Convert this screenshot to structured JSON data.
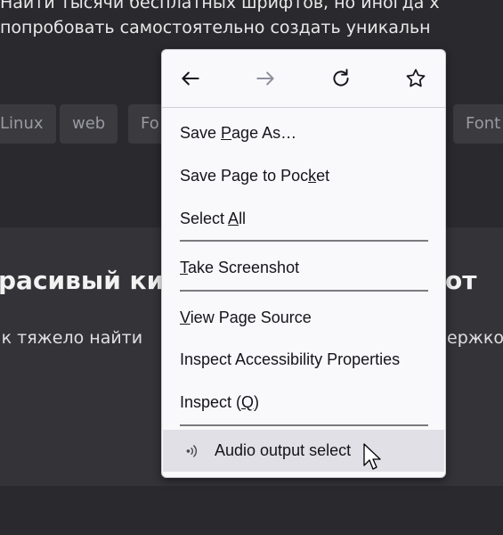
{
  "page": {
    "para_line1": "Найти тысячи бесплатных шрифтов, но иногда х",
    "para_line2": "попробовать самостоятельно создать уникальн",
    "tags": [
      "Linux",
      "web",
      "Fo",
      "Font"
    ],
    "heading_left": "расивый ки",
    "heading_right": "от",
    "body_left": "ак тяжело найти",
    "body_right": "ержко"
  },
  "context_menu": {
    "nav": {
      "back_icon": "arrow-left-icon",
      "forward_icon": "arrow-right-icon",
      "reload_icon": "reload-icon",
      "bookmark_icon": "star-icon"
    },
    "items": [
      {
        "pre": "Save ",
        "key": "P",
        "post": "age As…"
      },
      {
        "pre": "Save Page to Poc",
        "key": "k",
        "post": "et"
      },
      {
        "pre": "Select ",
        "key": "A",
        "post": "ll"
      },
      {
        "pre": "",
        "key": "T",
        "post": "ake Screenshot"
      },
      {
        "pre": "",
        "key": "V",
        "post": "iew Page Source"
      },
      {
        "pre": "Inspect Accessibility Properties",
        "key": "",
        "post": ""
      },
      {
        "pre": "Inspect (",
        "key": "Q",
        "post": ")"
      }
    ],
    "hovered_item": {
      "label": "Audio output select",
      "icon": "speaker-icon"
    }
  },
  "colors": {
    "page_bg": "#2a2a2e",
    "menu_bg": "#f9f9fb",
    "hover_bg": "#e0e0e6"
  }
}
